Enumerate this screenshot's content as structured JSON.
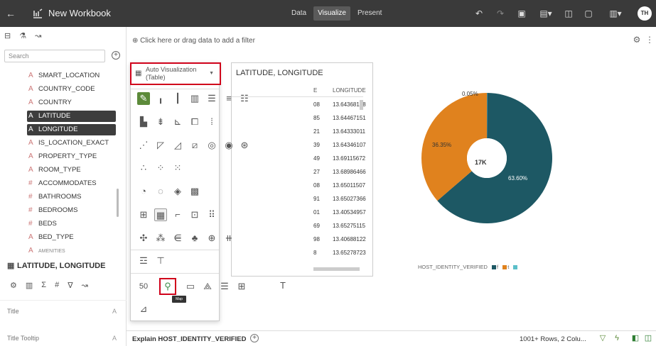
{
  "topbar": {
    "back_glyph": "←",
    "title": "New Workbook",
    "modes": [
      "Data",
      "Visualize",
      "Present"
    ],
    "active_mode": "Visualize",
    "icons": [
      "undo-icon",
      "redo-icon",
      "data-refresh-icon",
      "view-menu-icon",
      "canvas-icon",
      "preview-icon",
      "save-icon"
    ],
    "avatar_initials": "TH"
  },
  "left_panel": {
    "tabs": [
      "data-icon",
      "analytics-icon",
      "statistics-icon"
    ],
    "search_placeholder": "Search",
    "fields": [
      {
        "type": "A",
        "name": "SMART_LOCATION"
      },
      {
        "type": "A",
        "name": "COUNTRY_CODE"
      },
      {
        "type": "A",
        "name": "COUNTRY"
      },
      {
        "type": "A",
        "name": "LATITUDE",
        "selected": true
      },
      {
        "type": "A",
        "name": "LONGITUDE",
        "selected": true
      },
      {
        "type": "A",
        "name": "IS_LOCATION_EXACT"
      },
      {
        "type": "A",
        "name": "PROPERTY_TYPE"
      },
      {
        "type": "A",
        "name": "ROOM_TYPE"
      },
      {
        "type": "#",
        "name": "ACCOMMODATES"
      },
      {
        "type": "#",
        "name": "BATHROOMS"
      },
      {
        "type": "#",
        "name": "BEDROOMS"
      },
      {
        "type": "#",
        "name": "BEDS"
      },
      {
        "type": "A",
        "name": "BED_TYPE"
      },
      {
        "type": "A",
        "name": "AMENITIES"
      }
    ],
    "section_title": "LATITUDE, LONGITUDE",
    "property_rows": [
      {
        "label": "Title",
        "value": "A"
      },
      {
        "label": "Title Tooltip",
        "value": "A"
      }
    ]
  },
  "filter_bar": {
    "text": "Click here or drag data to add a filter"
  },
  "table_viz": {
    "title": "LATITUDE, LONGITUDE",
    "column_header": "LONGITUDE",
    "rows": [
      {
        "lat": "08",
        "lon": "13.64368178"
      },
      {
        "lat": "85",
        "lon": "13.64467151"
      },
      {
        "lat": "21",
        "lon": "13.64333011"
      },
      {
        "lat": "39",
        "lon": "13.64346107"
      },
      {
        "lat": "49",
        "lon": "13.69115672"
      },
      {
        "lat": "27",
        "lon": "13.68986466"
      },
      {
        "lat": "08",
        "lon": "13.65011507"
      },
      {
        "lat": "91",
        "lon": "13.65027366"
      },
      {
        "lat": "01",
        "lon": "13.40534957"
      },
      {
        "lat": "69",
        "lon": "13.65275115"
      },
      {
        "lat": "98",
        "lon": "13.40688122"
      },
      {
        "lat": "8",
        "lon": "13.65278723"
      }
    ]
  },
  "viz_picker": {
    "selected_label_line1": "Auto Visualization",
    "selected_label_line2": "(Table)",
    "map_tooltip": "Map",
    "icons": [
      [
        "auto-viz-icon",
        "bar-icon",
        "stacked-bar-icon",
        "100-stacked-bar-icon",
        "horizontal-bar-icon",
        "horizontal-stacked-icon",
        "horizontal-100-stacked-icon"
      ],
      [
        "combo-icon",
        "waterfall-icon",
        "line-bar-icon",
        "boxplot-icon",
        "parallel-icon"
      ],
      [
        "line-icon",
        "area-icon",
        "area-stacked-icon",
        "area-100-icon",
        "donut-icon",
        "radar-icon",
        "sunburst-icon"
      ],
      [
        "scatter-icon",
        "bubble-icon",
        "dot-icon"
      ],
      [
        "pie-icon",
        "donut-chart-icon",
        "treemap-icon",
        "heatmap-icon"
      ],
      [
        "pivot-icon",
        "table-icon",
        "timeline-icon",
        "correlation-icon",
        "tile-icon"
      ],
      [
        "network-icon",
        "sankey-icon",
        "funnel-icon",
        "tree-icon",
        "chord-icon",
        "gantt-icon"
      ],
      [
        "list-icon",
        "tag-cloud-icon"
      ],
      [
        "tile-number-icon",
        "map-icon",
        "text-box-icon",
        "custom-icon",
        "list-view-icon",
        "filter-bar-icon",
        "text-icon"
      ],
      [
        "image-icon"
      ]
    ]
  },
  "chart_data": {
    "type": "pie",
    "hole": true,
    "center_label": "17K",
    "slices": [
      {
        "label": "0.05%",
        "value": 0.05,
        "color": "#5bbfc9"
      },
      {
        "label": "36.35%",
        "value": 36.35,
        "color": "#e0821e"
      },
      {
        "label": "63.60%",
        "value": 63.6,
        "color": "#1d5864"
      }
    ],
    "legend_title": "HOST_IDENTITY_VERIFIED",
    "legend": [
      {
        "name": "f",
        "color": "#1d5864"
      },
      {
        "name": "t",
        "color": "#e0821e"
      },
      {
        "name": "",
        "color": "#5bbfc9"
      }
    ]
  },
  "bottom_bar": {
    "explain": "Explain HOST_IDENTITY_VERIFIED",
    "status": "1001+ Rows, 2 Colu..."
  }
}
